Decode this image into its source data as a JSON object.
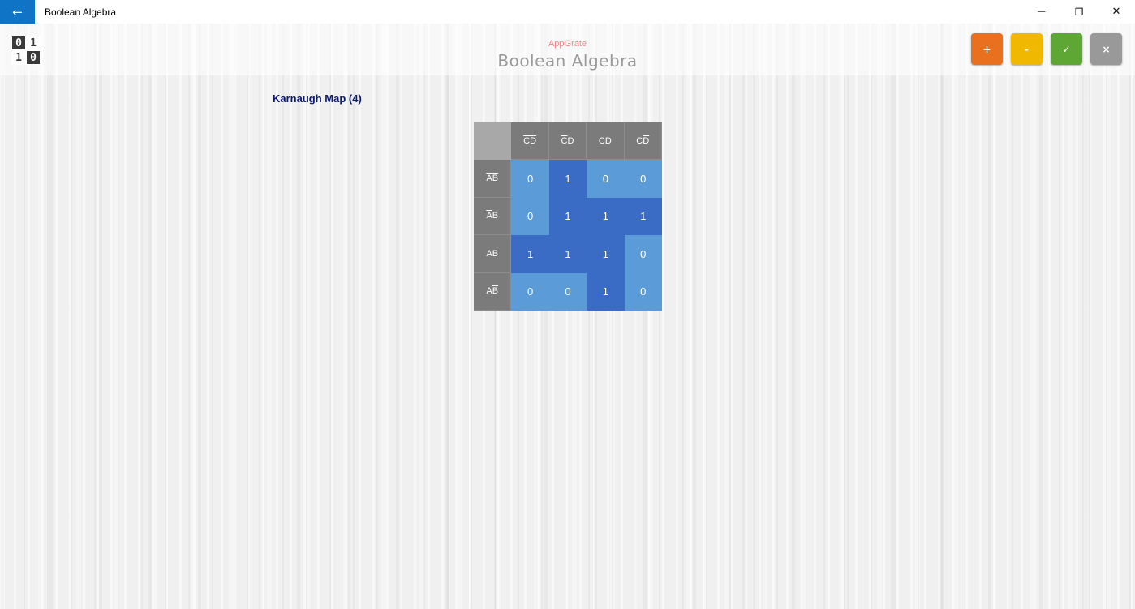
{
  "window": {
    "title": "Boolean Algebra",
    "minimize": "—",
    "restore": "❐",
    "close": "✕",
    "back": "←"
  },
  "header": {
    "brand": "AppGrate",
    "title": "Boolean Algebra",
    "logo": [
      "0",
      "1",
      "1",
      "0"
    ],
    "actions": [
      {
        "label": "+",
        "color": "#e8701e"
      },
      {
        "label": "-",
        "color": "#f1b800"
      },
      {
        "label": "✓",
        "color": "#5ea734"
      },
      {
        "label": "×",
        "color": "#999999"
      }
    ]
  },
  "section": {
    "title": "Karnaugh Map (4)"
  },
  "kmap": {
    "col_headers": [
      {
        "a": "C",
        "a_bar": true,
        "b": "D",
        "b_bar": true
      },
      {
        "a": "C",
        "a_bar": true,
        "b": "D",
        "b_bar": false
      },
      {
        "a": "C",
        "a_bar": false,
        "b": "D",
        "b_bar": false
      },
      {
        "a": "C",
        "a_bar": false,
        "b": "D",
        "b_bar": true
      }
    ],
    "row_headers": [
      {
        "a": "A",
        "a_bar": true,
        "b": "B",
        "b_bar": true
      },
      {
        "a": "A",
        "a_bar": true,
        "b": "B",
        "b_bar": false
      },
      {
        "a": "A",
        "a_bar": false,
        "b": "B",
        "b_bar": false
      },
      {
        "a": "A",
        "a_bar": false,
        "b": "B",
        "b_bar": true
      }
    ],
    "values": [
      [
        "0",
        "1",
        "0",
        "0"
      ],
      [
        "0",
        "1",
        "1",
        "1"
      ],
      [
        "1",
        "1",
        "1",
        "0"
      ],
      [
        "0",
        "0",
        "1",
        "0"
      ]
    ]
  }
}
